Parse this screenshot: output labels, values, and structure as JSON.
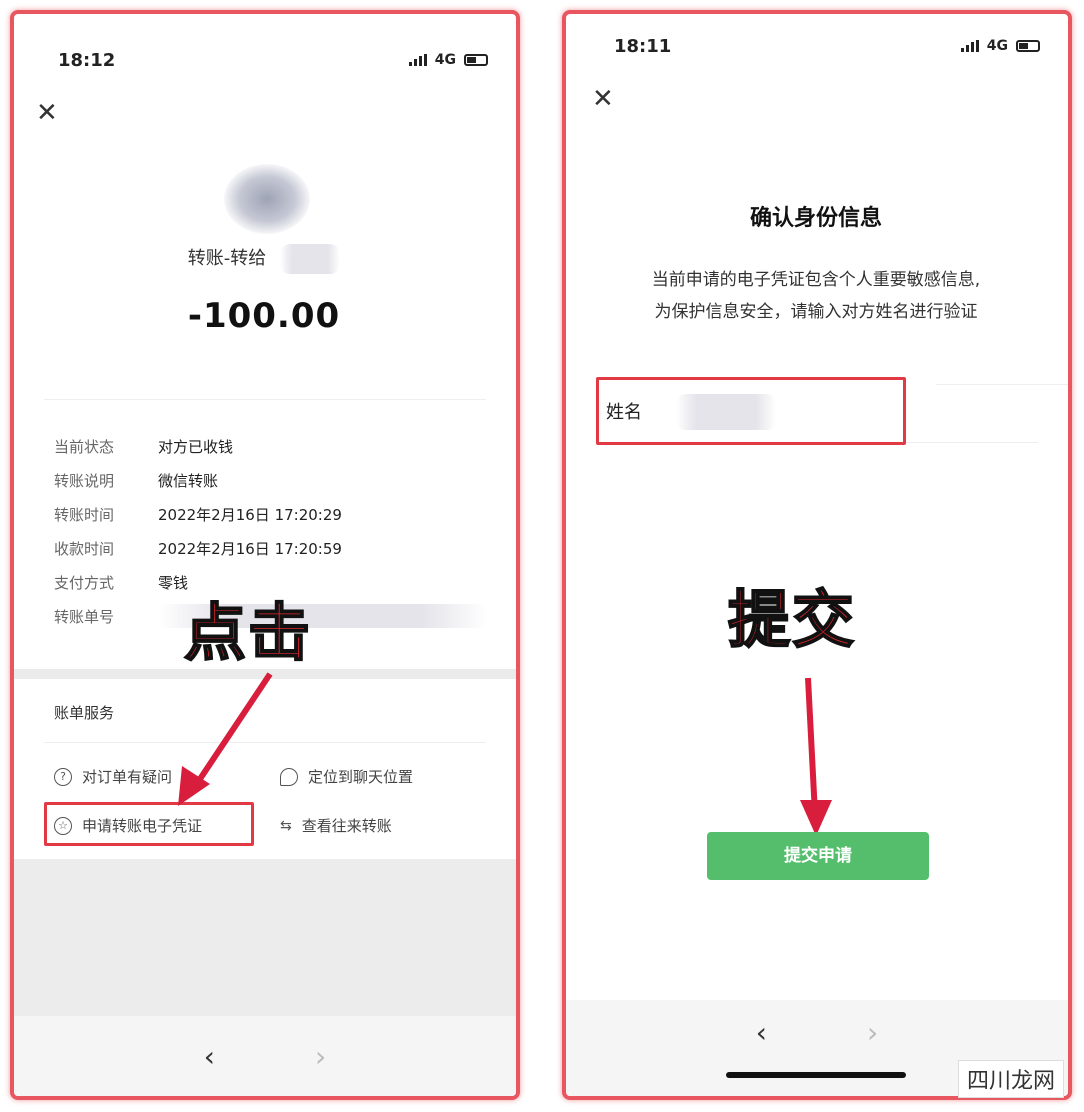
{
  "colors": {
    "frame": "#e8565f",
    "arrow": "#d81e3c",
    "submit_bg": "#55be6d",
    "label_red": "#e0262f"
  },
  "left": {
    "time": "18:12",
    "network": "4G",
    "transfer_title": "转账-转给",
    "amount": "-100.00",
    "rows": [
      {
        "key": "当前状态",
        "value": "对方已收钱"
      },
      {
        "key": "转账说明",
        "value": "微信转账"
      },
      {
        "key": "转账时间",
        "value": "2022年2月16日 17:20:29"
      },
      {
        "key": "收款时间",
        "value": "2022年2月16日 17:20:59"
      },
      {
        "key": "支付方式",
        "value": "零钱"
      },
      {
        "key": "转账单号",
        "value": ""
      }
    ],
    "services_title": "账单服务",
    "services": {
      "question": "对订单有疑问",
      "locate": "定位到聊天位置",
      "voucher": "申请转账电子凭证",
      "history": "查看往来转账"
    },
    "annotation": "点击",
    "nav_back": "‹",
    "nav_forward": "›"
  },
  "right": {
    "time": "18:11",
    "network": "4G",
    "title": "确认身份信息",
    "desc_line1": "当前申请的电子凭证包含个人重要敏感信息,",
    "desc_line2": "为保护信息安全，请输入对方姓名进行验证",
    "name_label": "姓名",
    "submit_label": "提交申请",
    "annotation": "提交",
    "nav_back": "‹",
    "nav_forward": "›"
  },
  "watermark": "四川龙网"
}
